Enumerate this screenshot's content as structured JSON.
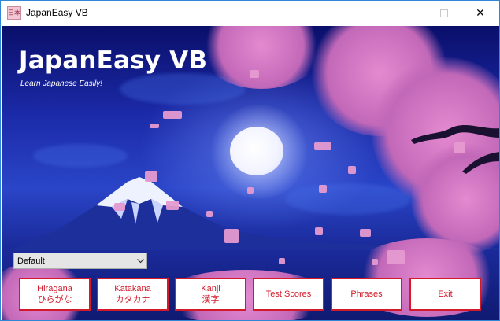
{
  "window": {
    "title": "JapanEasy VB",
    "icon_label": "日本",
    "minimize_symbol": "",
    "close_symbol": "✕"
  },
  "header": {
    "title": "JapanEasy VB",
    "subtitle": "Learn Japanese Easily!"
  },
  "theme_select": {
    "value": "Default"
  },
  "buttons": {
    "hiragana": {
      "line1": "Hiragana",
      "line2": "ひらがな"
    },
    "katakana": {
      "line1": "Katakana",
      "line2": "カタカナ"
    },
    "kanji": {
      "line1": "Kanji",
      "line2": "漢字"
    },
    "test_scores": {
      "line1": "Test Scores"
    },
    "phrases": {
      "line1": "Phrases"
    },
    "exit": {
      "line1": "Exit"
    }
  },
  "colors": {
    "accent": "#d21a2a",
    "sky": "#1b2aa8",
    "blossom": "#e59ad0"
  }
}
